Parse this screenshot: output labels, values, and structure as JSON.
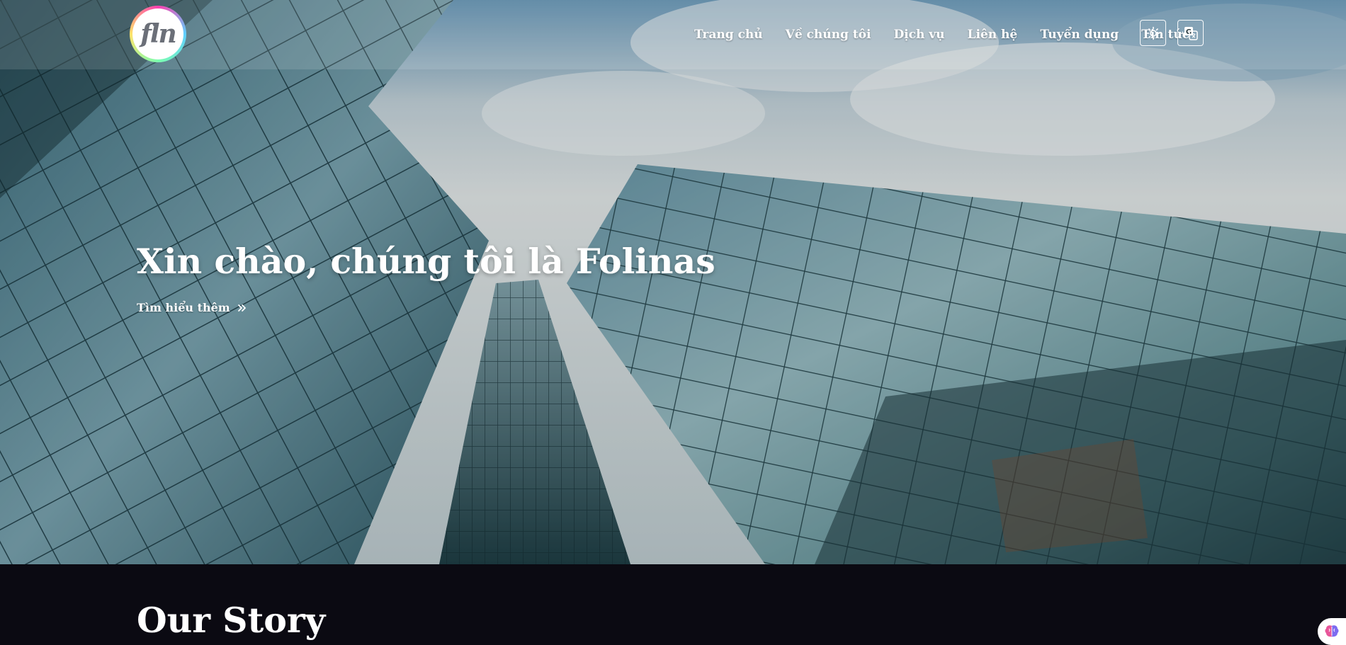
{
  "header": {
    "logo_text": "fln",
    "nav": [
      {
        "label": "Trang chủ"
      },
      {
        "label": "Về chúng tôi"
      },
      {
        "label": "Dịch vụ"
      },
      {
        "label": "Liên hệ"
      },
      {
        "label": "Tuyển dụng"
      },
      {
        "label": "Tin tức"
      }
    ],
    "theme_toggle_icon": "sun-icon",
    "language_icon": "translate-icon"
  },
  "hero": {
    "title": "Xin chào, chúng tôi là Folinas",
    "cta_label": "Tìm hiểu thêm",
    "cta_icon": "double-chevron-right-icon",
    "background": "glass skyscrapers viewed from below against a cloudy sky"
  },
  "story": {
    "heading": "Our Story"
  },
  "floating_widget": {
    "icon": "brain-icon"
  },
  "colors": {
    "dark_background": "#0b0a12",
    "text": "#ffffff"
  }
}
